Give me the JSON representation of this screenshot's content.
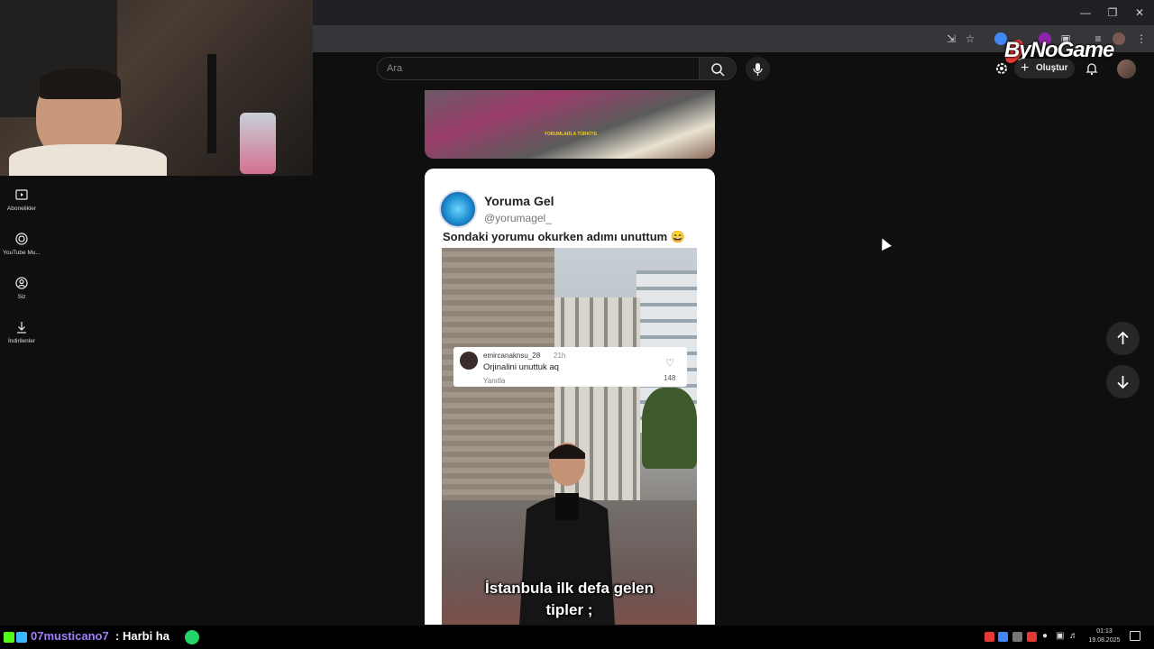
{
  "header": {
    "search_placeholder": "Ara",
    "create_label": "Oluştur",
    "overlay_brand": "ByNoGame"
  },
  "sidebar": {
    "items": [
      {
        "label": "Abonelikler",
        "icon": "subscriptions-icon"
      },
      {
        "label": "YouTube Mu...",
        "icon": "youtube-music-icon"
      },
      {
        "label": "Siz",
        "icon": "you-icon"
      },
      {
        "label": "İndirilenler",
        "icon": "download-icon"
      }
    ]
  },
  "short1": {
    "watermark": "YORUMLARLA TÜRKİYE"
  },
  "short2": {
    "channel_name": "Yoruma Gel",
    "channel_handle": "@yorumagel_",
    "caption": "Sondaki yorumu okurken adımı unuttum 😄",
    "comment": {
      "username": "emircanaknsu_28",
      "time": "21h",
      "text": "Orjinalini unuttuk aq",
      "reply_label": "Yanıtla",
      "likes": "148"
    },
    "subtitle_line1": "İstanbula ilk defa gelen",
    "subtitle_line2": "tipler ;"
  },
  "chat": {
    "username": "07musticano7",
    "separator": ":",
    "message": "Harbi ha"
  },
  "taskbar": {
    "time": "01:13",
    "date": "19.08.2025"
  },
  "colors": {
    "background": "#0f0f0f",
    "accent_red": "#e53935",
    "chat_user": "#a37dff"
  }
}
